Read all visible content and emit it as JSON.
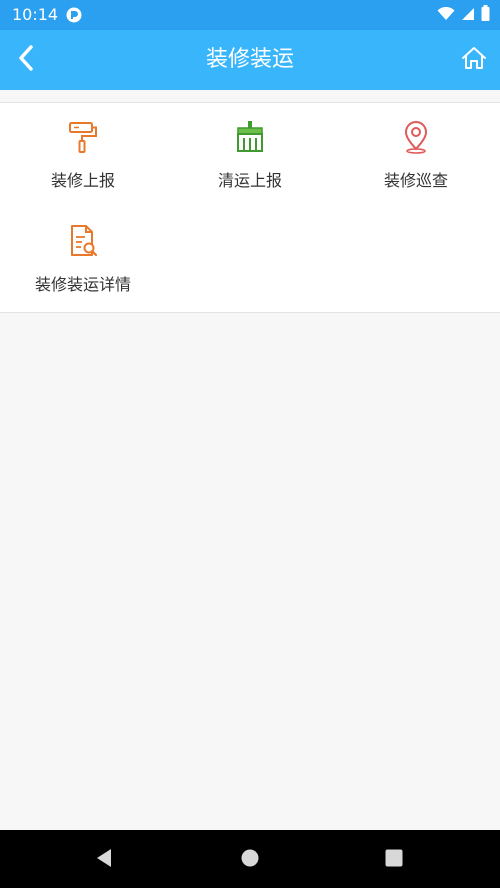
{
  "status_bar": {
    "time": "10:14",
    "icons": [
      "app-notification-icon",
      "wifi-icon",
      "signal-icon",
      "battery-icon"
    ]
  },
  "header": {
    "title": "装修装运",
    "back_icon": "chevron-left-icon",
    "home_icon": "home-icon",
    "background_color": "#39b6fb"
  },
  "menu": {
    "items": [
      {
        "label": "装修上报",
        "icon": "paint-roller-icon",
        "color": "#e8782b"
      },
      {
        "label": "清运上报",
        "icon": "broom-icon",
        "color": "#3f9b2f"
      },
      {
        "label": "装修巡查",
        "icon": "location-pin-icon",
        "color": "#e05a5a"
      },
      {
        "label": "装修装运详情",
        "icon": "document-search-icon",
        "color": "#e8782b"
      }
    ]
  },
  "nav_bar": {
    "icons": [
      "back-triangle-icon",
      "home-circle-icon",
      "recents-square-icon"
    ]
  }
}
